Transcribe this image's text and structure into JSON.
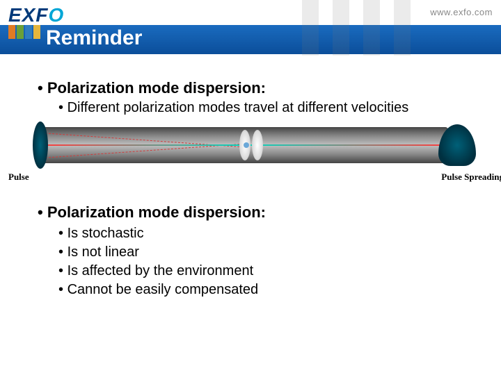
{
  "header": {
    "logo_main": "EXF",
    "logo_accent": "O",
    "url": "www.exfo.com",
    "title": "Reminder"
  },
  "section1": {
    "heading": "Polarization mode dispersion:",
    "sub": "Different polarization modes travel at different velocities"
  },
  "diagram": {
    "label_left": "Pulse",
    "label_right": "Pulse Spreading"
  },
  "section2": {
    "heading": "Polarization mode dispersion:",
    "items": [
      "Is stochastic",
      "Is not linear",
      "Is affected by the environment",
      "Cannot be easily compensated"
    ]
  }
}
